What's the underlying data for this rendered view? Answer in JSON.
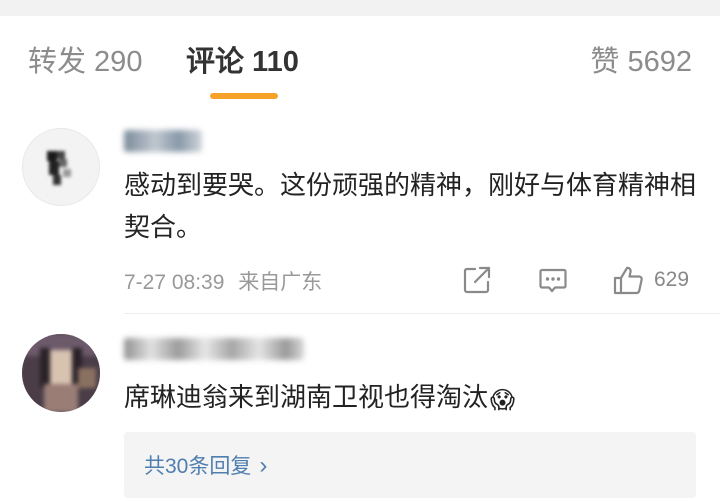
{
  "tabs": {
    "repost": "转发 290",
    "comments": "评论 110",
    "likes": "赞 5692"
  },
  "accent_color": "#f5a12a",
  "comments": [
    {
      "text": "感动到要哭。这份顽强的精神，刚好与体育精神相契合。",
      "time": "7-27 08:39",
      "source": "来自广东",
      "like_count": "629",
      "icons": [
        "share-icon",
        "reply-icon",
        "like-icon"
      ]
    },
    {
      "text": "席琳迪翁来到湖南卫视也得淘汰",
      "emoji": "😱",
      "replies_link": "共30条回复",
      "replies_chevron": "›"
    }
  ]
}
